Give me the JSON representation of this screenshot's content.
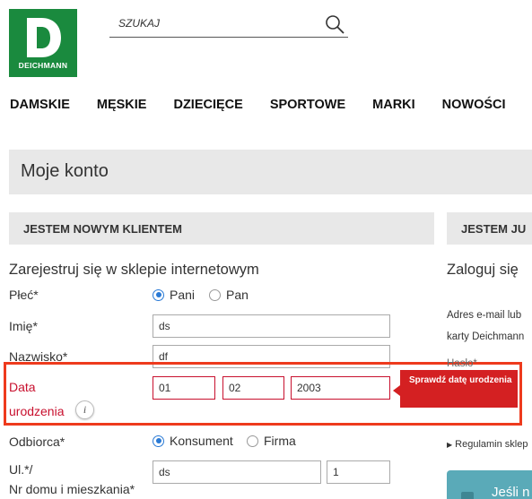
{
  "brand": {
    "logo_text": "DEICHMANN",
    "color": "#1a8a3e"
  },
  "search": {
    "placeholder": "SZUKAJ"
  },
  "nav": [
    {
      "label": "DAMSKIE"
    },
    {
      "label": "MĘSKIE"
    },
    {
      "label": "DZIECIĘCE"
    },
    {
      "label": "SPORTOWE"
    },
    {
      "label": "MARKI"
    },
    {
      "label": "NOWOŚCI"
    }
  ],
  "account": {
    "title": "Moje konto"
  },
  "register": {
    "header": "JESTEM NOWYM KLIENTEM",
    "title": "Zarejestruj się w sklepie internetowym",
    "gender": {
      "label": "Płeć*",
      "options": [
        {
          "label": "Pani",
          "selected": true
        },
        {
          "label": "Pan",
          "selected": false
        }
      ]
    },
    "first_name": {
      "label": "Imię*",
      "value": "ds"
    },
    "last_name": {
      "label": "Nazwisko*",
      "value": "df"
    },
    "birthdate": {
      "label_line1": "Data",
      "label_line2": "urodzenia",
      "day": "01",
      "month": "02",
      "year": "2003",
      "error_tooltip": "Sprawdź datę urodzenia",
      "info_icon": "i"
    },
    "recipient": {
      "label": "Odbiorca*",
      "options": [
        {
          "label": "Konsument",
          "selected": true
        },
        {
          "label": "Firma",
          "selected": false
        }
      ]
    },
    "street": {
      "label_line1": "Ul.*/",
      "label_line2": "Nr domu i mieszkania*",
      "street_value": "ds",
      "number_value": "1"
    }
  },
  "login": {
    "header": "JESTEM JU",
    "title": "Zaloguj się",
    "email_label_line1": "Adres e-mail lub",
    "email_label_line2": "karty Deichmann",
    "password_label": "Hasło*",
    "regulations_link": "Regulamin sklep",
    "button_label": "Jeśli n"
  },
  "colors": {
    "accent": "#2a7ad5",
    "error": "#c8102e",
    "highlight": "#ee3a1d",
    "tooltip": "#d42022",
    "button": "#5aaab8"
  }
}
